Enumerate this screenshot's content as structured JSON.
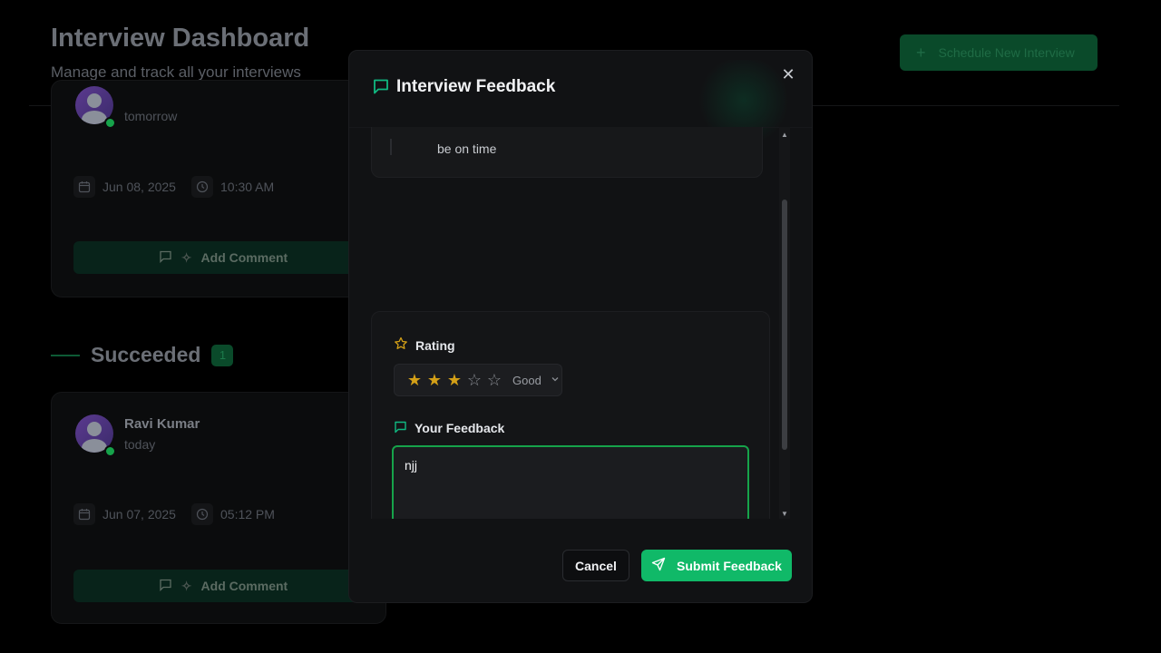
{
  "header": {
    "title": "Interview Dashboard",
    "subtitle": "Manage and track all your interviews",
    "schedule_button": "Schedule New Interview"
  },
  "cards": [
    {
      "when": "tomorrow",
      "date": "Jun 08, 2025",
      "time": "10:30 AM",
      "action": "Add Comment"
    },
    {
      "name": "Ravi Kumar",
      "when": "today",
      "date": "Jun 07, 2025",
      "time": "05:12 PM",
      "action": "Add Comment"
    }
  ],
  "section": {
    "label": "Succeeded",
    "count": "1"
  },
  "modal": {
    "title": "Interview Feedback",
    "previous_comment": "be on time",
    "rating_label": "Rating",
    "rating_value": 3,
    "rating_max": 5,
    "rating_text": "Good",
    "feedback_label": "Your Feedback",
    "feedback_value": "njj",
    "cancel": "Cancel",
    "submit": "Submit Feedback"
  },
  "colors": {
    "accent": "#10b968",
    "star": "#d4a017",
    "background": "#000000"
  }
}
